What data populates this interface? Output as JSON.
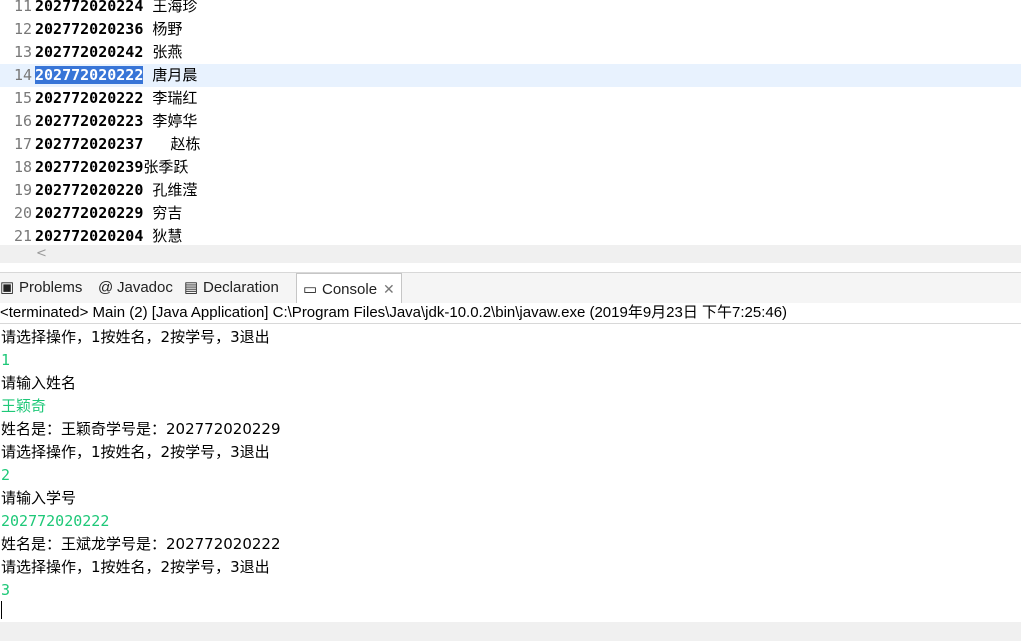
{
  "editor": {
    "lines": [
      {
        "num": "11",
        "id": "202772020224",
        "name": " 王海珍"
      },
      {
        "num": "12",
        "id": "202772020236",
        "name": " 杨野"
      },
      {
        "num": "13",
        "id": "202772020242",
        "name": " 张燕"
      },
      {
        "num": "14",
        "id": "202772020222",
        "name": " 唐月晨",
        "current": true
      },
      {
        "num": "15",
        "id": "202772020222",
        "name": " 李瑞红"
      },
      {
        "num": "16",
        "id": "202772020223",
        "name": " 李婷华"
      },
      {
        "num": "17",
        "id": "202772020237",
        "name": "   赵栋"
      },
      {
        "num": "18",
        "id": "202772020239",
        "name": "张季跃"
      },
      {
        "num": "19",
        "id": "202772020220",
        "name": " 孔维滢"
      },
      {
        "num": "20",
        "id": "202772020229",
        "name": " 穷吉"
      },
      {
        "num": "21",
        "id": "202772020204",
        "name": " 狄慧"
      }
    ],
    "scroll_arrow": "<"
  },
  "tabs": [
    {
      "label": "Problems",
      "icon": "problems-icon",
      "glyph": "▣"
    },
    {
      "label": "Javadoc",
      "icon": "javadoc-icon",
      "glyph": "@"
    },
    {
      "label": "Declaration",
      "icon": "declaration-icon",
      "glyph": "▤"
    },
    {
      "label": "Console",
      "icon": "console-icon",
      "glyph": "▭",
      "active": true,
      "close": "✕"
    }
  ],
  "console": {
    "launch_info": "<terminated> Main (2) [Java Application] C:\\Program Files\\Java\\jdk-10.0.2\\bin\\javaw.exe (2019年9月23日 下午7:25:46)",
    "lines": [
      {
        "text": "请选择操作，1按姓名，2按学号，3退出",
        "kind": "out"
      },
      {
        "text": "1",
        "kind": "in"
      },
      {
        "text": "请输入姓名",
        "kind": "out"
      },
      {
        "text": "王颖奇",
        "kind": "in"
      },
      {
        "text": "姓名是：王颖奇学号是：202772020229",
        "kind": "out"
      },
      {
        "text": "请选择操作，1按姓名，2按学号，3退出",
        "kind": "out"
      },
      {
        "text": "2",
        "kind": "in"
      },
      {
        "text": "请输入学号",
        "kind": "out"
      },
      {
        "text": "202772020222",
        "kind": "in"
      },
      {
        "text": "姓名是：王斌龙学号是：202772020222",
        "kind": "out"
      },
      {
        "text": "请选择操作，1按姓名，2按学号，3退出",
        "kind": "out"
      },
      {
        "text": "3",
        "kind": "in"
      }
    ]
  },
  "colors": {
    "selection": "#3875d7",
    "current_line": "#e8f2fe",
    "console_input": "#1ec878"
  }
}
